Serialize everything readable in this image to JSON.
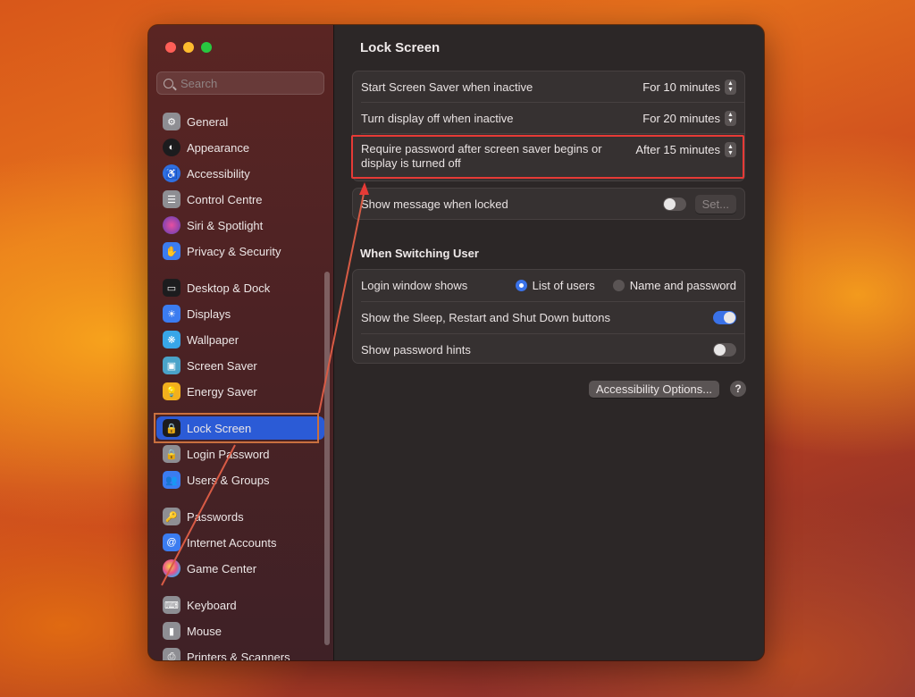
{
  "window": {
    "search": {
      "placeholder": "Search",
      "value": ""
    },
    "sidebar": {
      "items": [
        {
          "label": "General",
          "icon": "gear-icon",
          "color": "#8e8e93"
        },
        {
          "label": "Appearance",
          "icon": "appearance-icon",
          "color": "#1c1c1e"
        },
        {
          "label": "Accessibility",
          "icon": "accessibility-icon",
          "color": "#2f6fe0"
        },
        {
          "label": "Control Centre",
          "icon": "control-centre-icon",
          "color": "#8e8e93"
        },
        {
          "label": "Siri & Spotlight",
          "icon": "siri-icon",
          "color": "#5b3fb5"
        },
        {
          "label": "Privacy & Security",
          "icon": "hand-icon",
          "color": "#3b7cf0"
        },
        {
          "label": "Desktop & Dock",
          "icon": "dock-icon",
          "color": "#1c1c1e"
        },
        {
          "label": "Displays",
          "icon": "sun-icon",
          "color": "#3b7cf0"
        },
        {
          "label": "Wallpaper",
          "icon": "wallpaper-icon",
          "color": "#38a6e8"
        },
        {
          "label": "Screen Saver",
          "icon": "screen-saver-icon",
          "color": "#4aa3c9"
        },
        {
          "label": "Energy Saver",
          "icon": "bulb-icon",
          "color": "#f2b01d"
        },
        {
          "label": "Lock Screen",
          "icon": "lock-screen-icon",
          "color": "#1c1c1e",
          "active": true
        },
        {
          "label": "Login Password",
          "icon": "lock-icon",
          "color": "#8e8e93"
        },
        {
          "label": "Users & Groups",
          "icon": "users-icon",
          "color": "#3b7cf0"
        },
        {
          "label": "Passwords",
          "icon": "key-icon",
          "color": "#8e8e93"
        },
        {
          "label": "Internet Accounts",
          "icon": "at-icon",
          "color": "#3b7cf0"
        },
        {
          "label": "Game Center",
          "icon": "game-center-icon",
          "color": "#ffffff"
        },
        {
          "label": "Keyboard",
          "icon": "keyboard-icon",
          "color": "#8e8e93"
        },
        {
          "label": "Mouse",
          "icon": "mouse-icon",
          "color": "#8e8e93"
        },
        {
          "label": "Printers & Scanners",
          "icon": "printer-icon",
          "color": "#8e8e93"
        }
      ]
    },
    "main": {
      "title": "Lock Screen",
      "settings": [
        {
          "label": "Start Screen Saver when inactive",
          "value": "For 10 minutes"
        },
        {
          "label": "Turn display off when inactive",
          "value": "For 20 minutes"
        },
        {
          "label": "Require password after screen saver begins or display is turned off",
          "value": "After 15 minutes"
        }
      ],
      "message": {
        "label": "Show message when locked",
        "toggle": false,
        "button": "Set..."
      },
      "switching": {
        "title": "When Switching User",
        "login_label": "Login window shows",
        "options": [
          {
            "label": "List of users",
            "selected": true
          },
          {
            "label": "Name and password",
            "selected": false
          }
        ],
        "sleep_label": "Show the Sleep, Restart and Shut Down buttons",
        "sleep_toggle": true,
        "hints_label": "Show password hints",
        "hints_toggle": false
      },
      "accessibility_button": "Accessibility Options...",
      "help": "?"
    },
    "colors": {
      "accent": "#2b5bd6",
      "highlight": "#e63a36"
    }
  }
}
